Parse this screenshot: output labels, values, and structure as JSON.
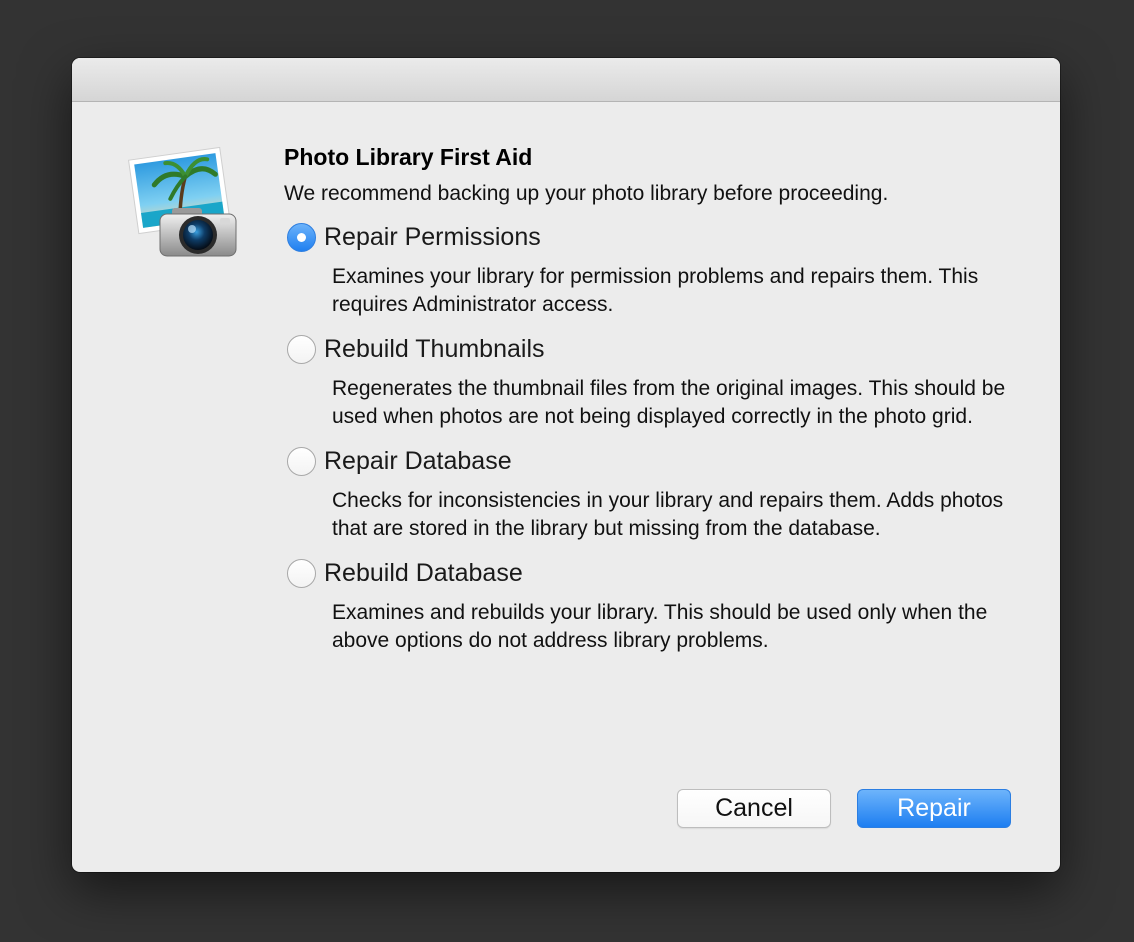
{
  "dialog": {
    "title": "Photo Library First Aid",
    "subtitle": "We recommend backing up your photo library before proceeding.",
    "app_icon": "iphoto-camera-icon"
  },
  "options": [
    {
      "label": "Repair Permissions",
      "description": "Examines your library for permission problems and repairs them. This requires Administrator access.",
      "selected": true
    },
    {
      "label": "Rebuild Thumbnails",
      "description": "Regenerates the thumbnail files from the original images. This should be used when photos are not being displayed correctly in the photo grid.",
      "selected": false
    },
    {
      "label": "Repair Database",
      "description": "Checks for inconsistencies in your library and repairs them. Adds photos that are stored in the library but missing from the database.",
      "selected": false
    },
    {
      "label": "Rebuild Database",
      "description": "Examines and rebuilds your library. This should be used only when the above options do not address library problems.",
      "selected": false
    }
  ],
  "buttons": {
    "cancel_label": "Cancel",
    "repair_label": "Repair"
  },
  "colors": {
    "accent": "#1f7ff0",
    "dialog_background": "#ececec",
    "backdrop": "#333333"
  }
}
